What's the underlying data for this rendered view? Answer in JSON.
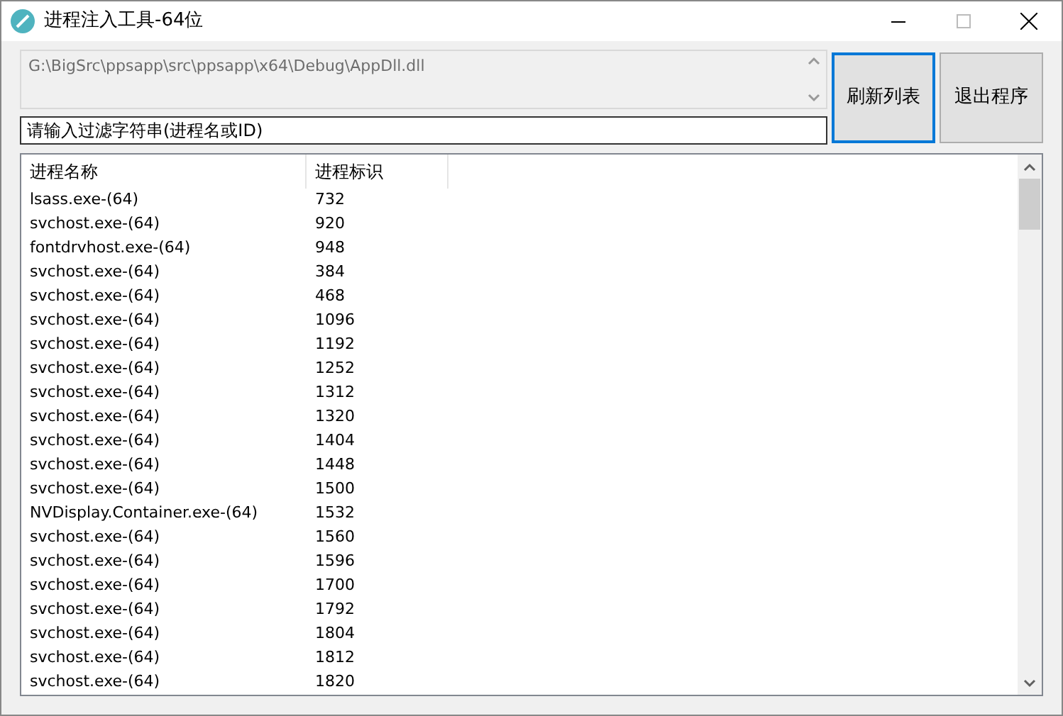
{
  "window": {
    "title": "进程注入工具-64位"
  },
  "path_box": {
    "value": "G:\\BigSrc\\ppsapp\\src\\ppsapp\\x64\\Debug\\AppDll.dll"
  },
  "filter": {
    "placeholder": "请输入过滤字符串(进程名或ID)"
  },
  "buttons": [
    {
      "label": "刷新列表",
      "focused": true
    },
    {
      "label": "退出程序",
      "focused": false
    }
  ],
  "table": {
    "columns": [
      "进程名称",
      "进程标识"
    ],
    "rows": [
      [
        "lsass.exe-(64)",
        "732"
      ],
      [
        "svchost.exe-(64)",
        "920"
      ],
      [
        "fontdrvhost.exe-(64)",
        "948"
      ],
      [
        "svchost.exe-(64)",
        "384"
      ],
      [
        "svchost.exe-(64)",
        "468"
      ],
      [
        "svchost.exe-(64)",
        "1096"
      ],
      [
        "svchost.exe-(64)",
        "1192"
      ],
      [
        "svchost.exe-(64)",
        "1252"
      ],
      [
        "svchost.exe-(64)",
        "1312"
      ],
      [
        "svchost.exe-(64)",
        "1320"
      ],
      [
        "svchost.exe-(64)",
        "1404"
      ],
      [
        "svchost.exe-(64)",
        "1448"
      ],
      [
        "svchost.exe-(64)",
        "1500"
      ],
      [
        "NVDisplay.Container.exe-(64)",
        "1532"
      ],
      [
        "svchost.exe-(64)",
        "1560"
      ],
      [
        "svchost.exe-(64)",
        "1596"
      ],
      [
        "svchost.exe-(64)",
        "1700"
      ],
      [
        "svchost.exe-(64)",
        "1792"
      ],
      [
        "svchost.exe-(64)",
        "1804"
      ],
      [
        "svchost.exe-(64)",
        "1812"
      ],
      [
        "svchost.exe-(64)",
        "1820"
      ]
    ]
  }
}
